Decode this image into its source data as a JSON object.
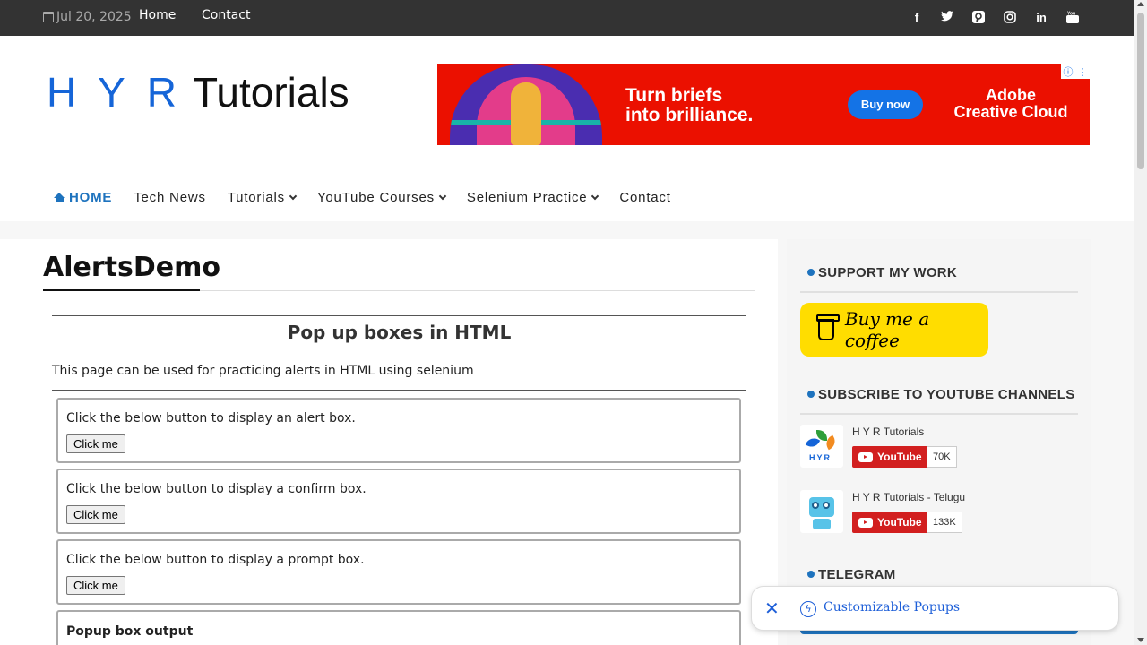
{
  "topbar": {
    "date": "Jul 20, 2025",
    "links": [
      "Home",
      "Contact"
    ],
    "social_icons": [
      "facebook-icon",
      "twitter-icon",
      "pinterest-icon",
      "instagram-icon",
      "linkedin-icon",
      "youtube-icon"
    ]
  },
  "header": {
    "logo_hyr": "H Y R",
    "logo_tutorials": "Tutorials",
    "ad": {
      "headline_line1": "Turn briefs",
      "headline_line2": "into brilliance.",
      "cta": "Buy now",
      "brand_line1": "Adobe",
      "brand_line2": "Creative Cloud",
      "bg_color": "#eb1000",
      "cta_color": "#1473e6"
    }
  },
  "nav": {
    "items": [
      {
        "label": "HOME",
        "active": true
      },
      {
        "label": "Tech News"
      },
      {
        "label": "Tutorials",
        "dropdown": true
      },
      {
        "label": "YouTube Courses",
        "dropdown": true
      },
      {
        "label": "Selenium Practice",
        "dropdown": true
      },
      {
        "label": "Contact"
      }
    ],
    "accent_color": "#1e73be"
  },
  "main": {
    "page_title": "AlertsDemo",
    "heading": "Pop up boxes in HTML",
    "intro": "This page can be used for practicing alerts in HTML using selenium",
    "boxes": [
      {
        "label": "Click the below button to display an alert box.",
        "button": "Click me"
      },
      {
        "label": "Click the below button to display a confirm box.",
        "button": "Click me"
      },
      {
        "label": "Click the below button to display a prompt box.",
        "button": "Click me"
      }
    ],
    "output_label": "Popup box output"
  },
  "sidebar": {
    "support_title": "SUPPORT MY WORK",
    "coffee_label": "Buy me a coffee",
    "subscribe_title": "SUBSCRIBE TO YOUTUBE CHANNELS",
    "channels": [
      {
        "name": "H Y R Tutorials",
        "button": "YouTube",
        "count": "70K"
      },
      {
        "name": "H Y R Tutorials - Telugu",
        "button": "YouTube",
        "count": "133K"
      }
    ],
    "telegram_title": "TELEGRAM"
  },
  "toast": {
    "label": "Customizable Popups",
    "color": "#1e5fd8"
  }
}
